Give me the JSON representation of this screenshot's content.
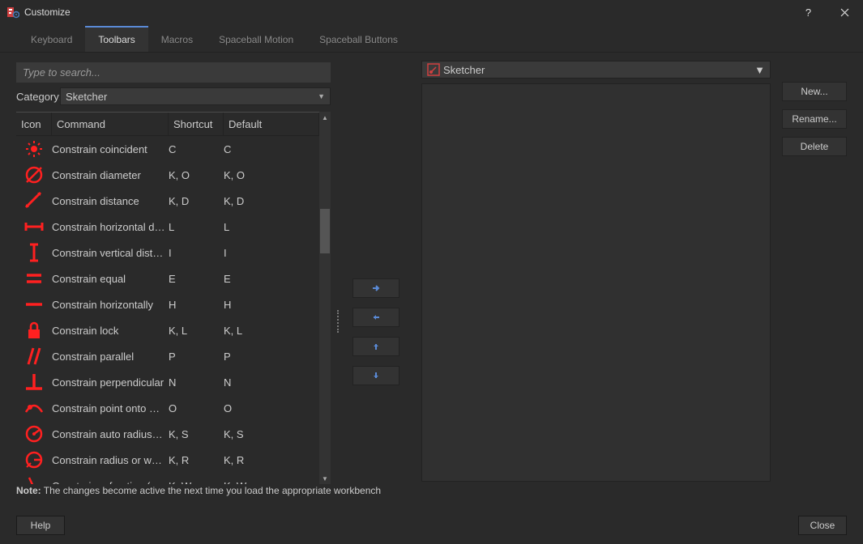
{
  "window": {
    "title": "Customize"
  },
  "tabs": [
    {
      "label": "Keyboard"
    },
    {
      "label": "Toolbars"
    },
    {
      "label": "Macros"
    },
    {
      "label": "Spaceball Motion"
    },
    {
      "label": "Spaceball Buttons"
    }
  ],
  "search": {
    "placeholder": "Type to search..."
  },
  "category": {
    "label": "Category:",
    "value": "Sketcher"
  },
  "columns": {
    "icon": "Icon",
    "cmd": "Command",
    "sc": "Shortcut",
    "def": "Default"
  },
  "rows": [
    {
      "icon": "coincident",
      "cmd": "Constrain coincident",
      "sc": "C",
      "def": "C"
    },
    {
      "icon": "diameter",
      "cmd": "Constrain diameter",
      "sc": "K, O",
      "def": "K, O"
    },
    {
      "icon": "distance",
      "cmd": "Constrain distance",
      "sc": "K, D",
      "def": "K, D"
    },
    {
      "icon": "hdist",
      "cmd": "Constrain horizontal dist...",
      "sc": "L",
      "def": "L"
    },
    {
      "icon": "vdist",
      "cmd": "Constrain vertical distance",
      "sc": "I",
      "def": "I"
    },
    {
      "icon": "equal",
      "cmd": "Constrain equal",
      "sc": "E",
      "def": "E"
    },
    {
      "icon": "horiz",
      "cmd": "Constrain horizontally",
      "sc": "H",
      "def": "H"
    },
    {
      "icon": "lock",
      "cmd": "Constrain lock",
      "sc": "K, L",
      "def": "K, L"
    },
    {
      "icon": "parallel",
      "cmd": "Constrain parallel",
      "sc": "P",
      "def": "P"
    },
    {
      "icon": "perp",
      "cmd": "Constrain perpendicular",
      "sc": "N",
      "def": "N"
    },
    {
      "icon": "pointon",
      "cmd": "Constrain point onto ob...",
      "sc": "O",
      "def": "O"
    },
    {
      "icon": "autorad",
      "cmd": "Constrain auto radius/di...",
      "sc": "K, S",
      "def": "K, S"
    },
    {
      "icon": "radius",
      "cmd": "Constrain radius or weight",
      "sc": "K, R",
      "def": "K, R"
    },
    {
      "icon": "refraction",
      "cmd": "Constrain refraction (Sn...",
      "sc": "K, W",
      "def": "K, W"
    }
  ],
  "toolbar_select": {
    "value": "Sketcher"
  },
  "buttons": {
    "new": "New...",
    "rename": "Rename...",
    "delete": "Delete"
  },
  "note": {
    "bold": "Note:",
    "text": " The changes become active the next time you load the appropriate workbench"
  },
  "footer": {
    "help": "Help",
    "close": "Close"
  }
}
